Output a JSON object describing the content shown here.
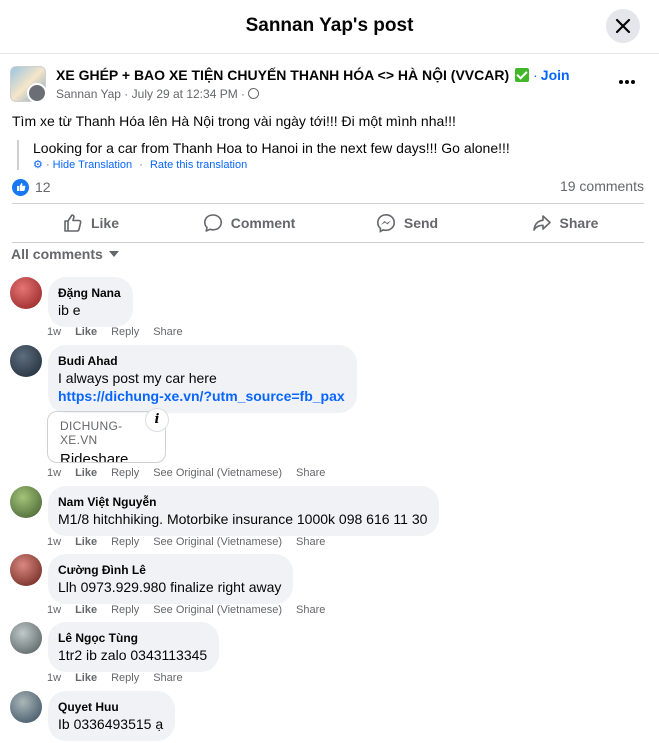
{
  "header": {
    "title": "Sannan Yap's post"
  },
  "post": {
    "group_name": "XE GHÉP + BAO XE TIỆN CHUYẾN THANH HÓA <> HÀ NỘI (VVCAR)",
    "join_label": "Join",
    "author": "Sannan Yap",
    "date": "July 29 at 12:34 PM",
    "text": "Tìm xe từ Thanh Hóa lên Hà Nội trong vài ngày tới!!! Đi một mình nha!!!",
    "translation": "Looking for a car from Thanh Hoa to Hanoi in the next few days!!! Go alone!!!",
    "hide_translation": "Hide Translation",
    "rate_translation": "Rate this translation",
    "reaction_count": "12",
    "comment_count": "19 comments"
  },
  "actions": {
    "like": "Like",
    "comment": "Comment",
    "send": "Send",
    "share": "Share"
  },
  "comments_filter": "All comments",
  "comments": [
    {
      "name": "Đặng Nana",
      "text": "ib e",
      "time": "1w",
      "actions": [
        "Like",
        "Reply",
        "Share"
      ],
      "avatar_color": "#c0392b"
    },
    {
      "name": "Budi Ahad",
      "text": "I always post my car here",
      "link": "https://dichung-xe.vn/?utm_source=fb_pax",
      "time": "1w",
      "actions": [
        "Like",
        "Reply",
        "See Original (Vietnamese)",
        "Share"
      ],
      "avatar_color": "#2c3e50"
    },
    {
      "name": "Nam Việt Nguyễn",
      "text": "M1/8 hitchhiking. Motorbike insurance 1000k 098 616 11 30",
      "time": "1w",
      "actions": [
        "Like",
        "Reply",
        "See Original (Vietnamese)",
        "Share"
      ],
      "avatar_color": "#6b8e4e"
    },
    {
      "name": "Cường Đình Lê",
      "text": "Llh 0973.929.980 finalize right away",
      "time": "1w",
      "actions": [
        "Like",
        "Reply",
        "See Original (Vietnamese)",
        "Share"
      ],
      "avatar_color": "#8e2c2c"
    },
    {
      "name": "Lê Ngọc Tùng",
      "text": "1tr2 ib zalo 0343113345",
      "time": "1w",
      "actions": [
        "Like",
        "Reply",
        "Share"
      ],
      "avatar_color": "#7f8c8d"
    },
    {
      "name": "Quyet Huu",
      "text": "Ib 0336493515 ạ",
      "avatar_color": "#5d6d7e"
    }
  ],
  "link_preview": {
    "domain": "DICHUNG-XE.VN",
    "title": "Rideshare"
  },
  "colors": {
    "accent": "#0866ff",
    "bubble": "#f0f2f5",
    "muted": "#65676b"
  }
}
